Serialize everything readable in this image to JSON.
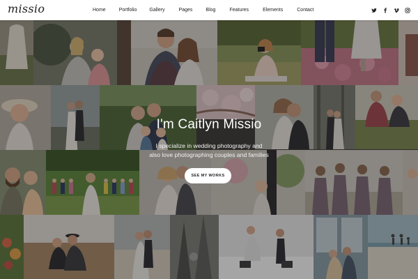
{
  "header": {
    "logo": "missio",
    "nav": [
      {
        "label": "Home"
      },
      {
        "label": "Portfolio"
      },
      {
        "label": "Gallery"
      },
      {
        "label": "Pages"
      },
      {
        "label": "Blog"
      },
      {
        "label": "Features"
      },
      {
        "label": "Elements"
      },
      {
        "label": "Contact"
      }
    ],
    "social": [
      "twitter-icon",
      "facebook-icon",
      "vimeo-icon",
      "instagram-icon"
    ]
  },
  "hero": {
    "title": "I'm Caitlyn Missio",
    "subtitle_line1": "I specialize in wedding photography and",
    "subtitle_line2": "also love photographing couples and families",
    "button_label": "SEE MY WORKS"
  },
  "colors": {
    "header_bg": "#ffffff",
    "text_dark": "#222222",
    "hero_text": "#ffffff",
    "button_bg": "#ffffff"
  }
}
